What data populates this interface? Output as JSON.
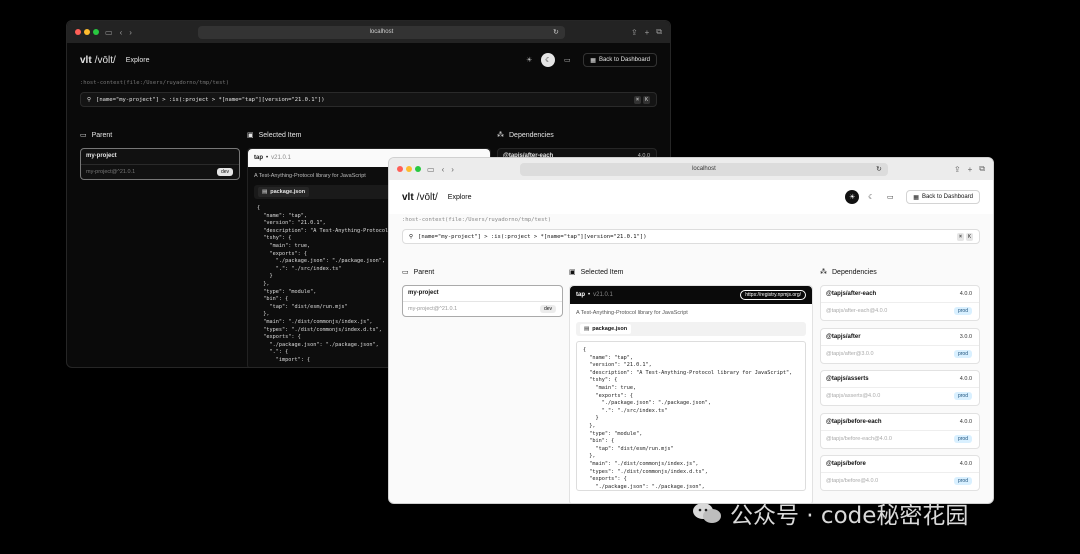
{
  "dark": {
    "url": "localhost",
    "logo": "vlt",
    "logo_phonetic": "/vōlt/",
    "nav_explore": "Explore",
    "back_label": "Back to Dashboard",
    "context": ":host-context(file:/Users/ruyadorno/tmp/test)",
    "query": "[name=\"my-project\"] > :is(:project > *[name=\"tap\"][version=\"21.0.1\"])",
    "kbd": [
      "⌘",
      "K"
    ],
    "parent_heading": "Parent",
    "selected_heading": "Selected Item",
    "deps_heading": "Dependencies",
    "parent_card": {
      "name": "my-project",
      "spec": "my-project@^21.0.1",
      "badge": "dev"
    },
    "selected": {
      "name": "tap",
      "version": "v21.0.1",
      "description": "A Test-Anything-Protocol library for JavaScript",
      "tab": "package.json"
    },
    "dep_partial": {
      "name": "@tapjs/after-each",
      "version": "4.0.0"
    },
    "code": "{\n  \"name\": \"tap\",\n  \"version\": \"21.0.1\",\n  \"description\": \"A Test-Anything-Protocol\n  \"tshy\": {\n    \"main\": true,\n    \"exports\": {\n      \"./package.json\": \"./package.json\",\n      \".\": \"./src/index.ts\"\n    }\n  },\n  \"type\": \"module\",\n  \"bin\": {\n    \"tap\": \"dist/esm/run.mjs\"\n  },\n  \"main\": \"./dist/commonjs/index.js\",\n  \"types\": \"./dist/commonjs/index.d.ts\",\n  \"exports\": {\n    \"./package.json\": \"./package.json\",\n    \".\": {\n      \"import\": {"
  },
  "light": {
    "url": "localhost",
    "logo": "vlt",
    "logo_phonetic": "/vōlt/",
    "nav_explore": "Explore",
    "back_label": "Back to Dashboard",
    "context": ":host-context(file:/Users/ruyadorno/tmp/test)",
    "query": "[name=\"my-project\"] > :is(:project > *[name=\"tap\"][version=\"21.0.1\"])",
    "kbd": [
      "⌘",
      "K"
    ],
    "parent_heading": "Parent",
    "selected_heading": "Selected Item",
    "deps_heading": "Dependencies",
    "parent_card": {
      "name": "my-project",
      "spec": "my-project@^21.0.1",
      "badge": "dev"
    },
    "selected": {
      "name": "tap",
      "version": "v21.0.1",
      "registry": "https://registry.npmjs.org/",
      "description": "A Test-Anything-Protocol library for JavaScript",
      "tab": "package.json"
    },
    "dependencies": [
      {
        "name": "@tapjs/after-each",
        "version": "4.0.0",
        "spec": "@tapjs/after-each@4.0.0",
        "badge": "prod"
      },
      {
        "name": "@tapjs/after",
        "version": "3.0.0",
        "spec": "@tapjs/after@3.0.0",
        "badge": "prod"
      },
      {
        "name": "@tapjs/asserts",
        "version": "4.0.0",
        "spec": "@tapjs/asserts@4.0.0",
        "badge": "prod"
      },
      {
        "name": "@tapjs/before-each",
        "version": "4.0.0",
        "spec": "@tapjs/before-each@4.0.0",
        "badge": "prod"
      },
      {
        "name": "@tapjs/before",
        "version": "4.0.0",
        "spec": "@tapjs/before@4.0.0",
        "badge": "prod"
      }
    ],
    "code": "{\n  \"name\": \"tap\",\n  \"version\": \"21.0.1\",\n  \"description\": \"A Test-Anything-Protocol library for JavaScript\",\n  \"tshy\": {\n    \"main\": true,\n    \"exports\": {\n      \"./package.json\": \"./package.json\",\n      \".\": \"./src/index.ts\"\n    }\n  },\n  \"type\": \"module\",\n  \"bin\": {\n    \"tap\": \"dist/esm/run.mjs\"\n  },\n  \"main\": \"./dist/commonjs/index.js\",\n  \"types\": \"./dist/commonjs/index.d.ts\",\n  \"exports\": {\n    \"./package.json\": \"./package.json\",\n    \".\": {\n      \"import\": {\n        \"types\": \"./dist/esm/index.d.ts\","
  },
  "watermark": "公众号 · code秘密花园"
}
